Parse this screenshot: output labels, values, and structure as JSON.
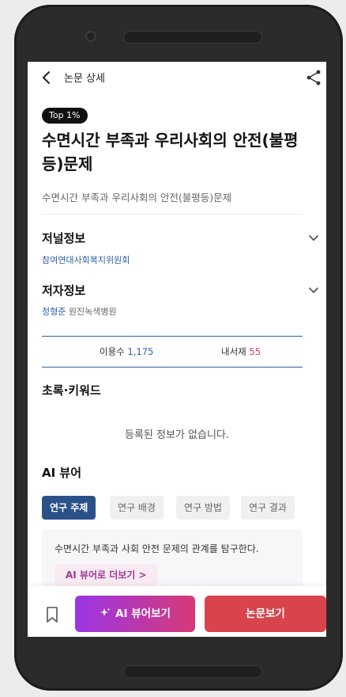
{
  "header": {
    "title": "논문 상세"
  },
  "paper": {
    "badge": "Top 1%",
    "title": "수면시간 부족과 우리사회의 안전(불평등)문제",
    "subtitle": "수면시간 부족과 우리사회의 안전(불평등)문제"
  },
  "journal": {
    "heading": "저널정보",
    "name": "참여연대사회복지위원회"
  },
  "author": {
    "heading": "저자정보",
    "name": "정형준",
    "affiliation": "원진녹색병원"
  },
  "stats": {
    "use_label": "이용수",
    "use_count": "1,175",
    "dl_label": "내서재",
    "dl_count": "55"
  },
  "abstract": {
    "heading": "초록·키워드",
    "empty_text": "등록된 정보가 없습니다."
  },
  "ai_viewer": {
    "heading": "AI 뷰어",
    "tabs": [
      "연구 주제",
      "연구 배경",
      "연구 방법",
      "연구 결과"
    ],
    "active_tab": 0,
    "summary": "수면시간 부족과 사회 안전 문제의 관계를 탐구한다.",
    "more_label": "AI 뷰어로 더보기 >"
  },
  "actions": {
    "ai_button": "AI 뷰어보기",
    "ai_icon": "sparkle-icon",
    "paper_button": "논문보기"
  },
  "colors": {
    "accent_blue": "#2b5288",
    "link_blue": "#2b5fa6",
    "accent_red": "#d9434b",
    "gradient_start": "#9b36e6",
    "gradient_end": "#d53a77"
  }
}
